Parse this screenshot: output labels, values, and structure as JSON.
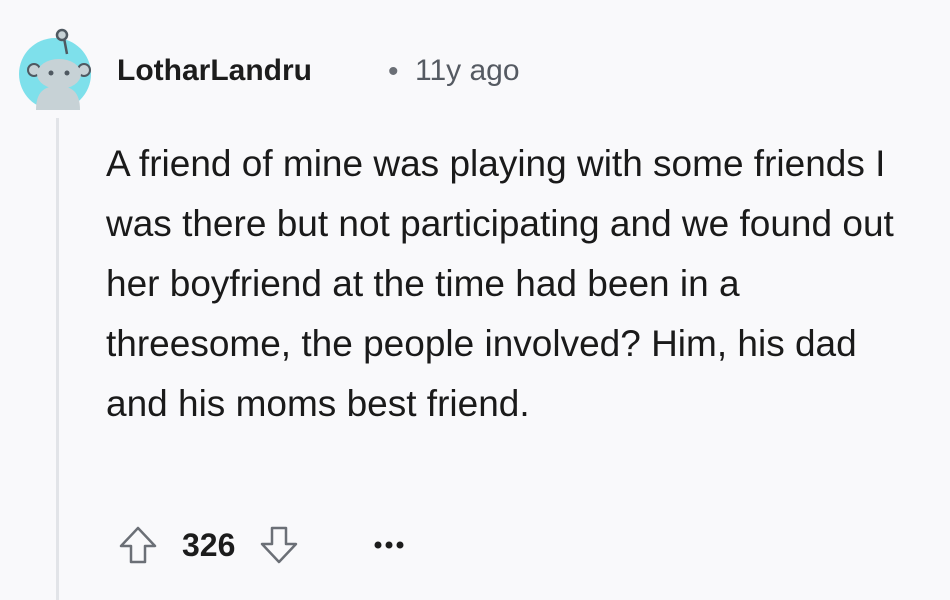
{
  "comment": {
    "author": "LotharLandru",
    "separator": "•",
    "timestamp": "11y ago",
    "body": "A friend of mine was playing with some friends I was there but not participating and we found out her boyfriend at the time had been in a threesome, the people involved? Him, his dad and his moms best friend.",
    "score": "326"
  },
  "icons": {
    "avatar": "reddit-snoo-avatar-icon",
    "upvote": "arrow-up-icon",
    "downvote": "arrow-down-icon",
    "more": "more-options-icon"
  },
  "colors": {
    "background": "#f9f9fb",
    "avatar_bg": "#7ee0eb",
    "icon_gray": "#6b6f76",
    "thread_line": "#e2e4e8"
  }
}
